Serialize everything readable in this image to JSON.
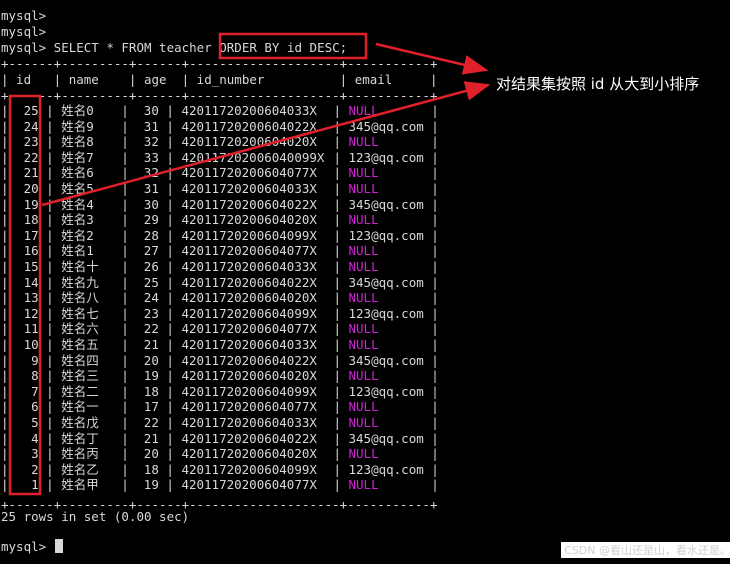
{
  "terminal": {
    "prompt_lines": [
      "mysql>",
      "mysql>"
    ],
    "query": "mysql> SELECT * FROM teacher ORDER BY id DESC;",
    "border": "+------+---------+------+--------------------+-----------+",
    "header": "| id   | name    | age  | id_number          | email     |",
    "columns": [
      "id",
      "name",
      "age",
      "id_number",
      "email"
    ],
    "rows": [
      [
        "25",
        "姓名0",
        "30",
        "42011720200604033X",
        "NULL"
      ],
      [
        "24",
        "姓名9",
        "31",
        "42011720200604022X",
        "345@qq.com"
      ],
      [
        "23",
        "姓名8",
        "32",
        "42011720200604020X",
        "NULL"
      ],
      [
        "22",
        "姓名7",
        "33",
        "420117202006040099X",
        "123@qq.com"
      ],
      [
        "21",
        "姓名6",
        "32",
        "42011720200604077X",
        "NULL"
      ],
      [
        "20",
        "姓名5",
        "31",
        "42011720200604033X",
        "NULL"
      ],
      [
        "19",
        "姓名4",
        "30",
        "42011720200604022X",
        "345@qq.com"
      ],
      [
        "18",
        "姓名3",
        "29",
        "42011720200604020X",
        "NULL"
      ],
      [
        "17",
        "姓名2",
        "28",
        "42011720200604099X",
        "123@qq.com"
      ],
      [
        "16",
        "姓名1",
        "27",
        "42011720200604077X",
        "NULL"
      ],
      [
        "15",
        "姓名十",
        "26",
        "42011720200604033X",
        "NULL"
      ],
      [
        "14",
        "姓名九",
        "25",
        "42011720200604022X",
        "345@qq.com"
      ],
      [
        "13",
        "姓名八",
        "24",
        "42011720200604020X",
        "NULL"
      ],
      [
        "12",
        "姓名七",
        "23",
        "42011720200604099X",
        "123@qq.com"
      ],
      [
        "11",
        "姓名六",
        "22",
        "42011720200604077X",
        "NULL"
      ],
      [
        "10",
        "姓名五",
        "21",
        "42011720200604033X",
        "NULL"
      ],
      [
        "9",
        "姓名四",
        "20",
        "42011720200604022X",
        "345@qq.com"
      ],
      [
        "8",
        "姓名三",
        "19",
        "42011720200604020X",
        "NULL"
      ],
      [
        "7",
        "姓名二",
        "18",
        "42011720200604099X",
        "123@qq.com"
      ],
      [
        "6",
        "姓名一",
        "17",
        "42011720200604077X",
        "NULL"
      ],
      [
        "5",
        "姓名戊",
        "22",
        "42011720200604033X",
        "NULL"
      ],
      [
        "4",
        "姓名丁",
        "21",
        "42011720200604022X",
        "345@qq.com"
      ],
      [
        "3",
        "姓名丙",
        "20",
        "42011720200604020X",
        "NULL"
      ],
      [
        "2",
        "姓名乙",
        "18",
        "42011720200604099X",
        "123@qq.com"
      ],
      [
        "1",
        "姓名甲",
        "19",
        "42011720200604077X",
        "NULL"
      ]
    ],
    "result_summary": "25 rows in set (0.00 sec)",
    "final_prompt": "mysql> "
  },
  "annotation": {
    "text": "对结果集按照 id 从大到小排序"
  },
  "watermark": "CSDN @看山还是山，看水还是。",
  "colors": {
    "background": "#000000",
    "text": "#d8d8d8",
    "null_value": "#d020d8",
    "highlight_box": "#e0202a",
    "arrow": "#e0202a"
  }
}
